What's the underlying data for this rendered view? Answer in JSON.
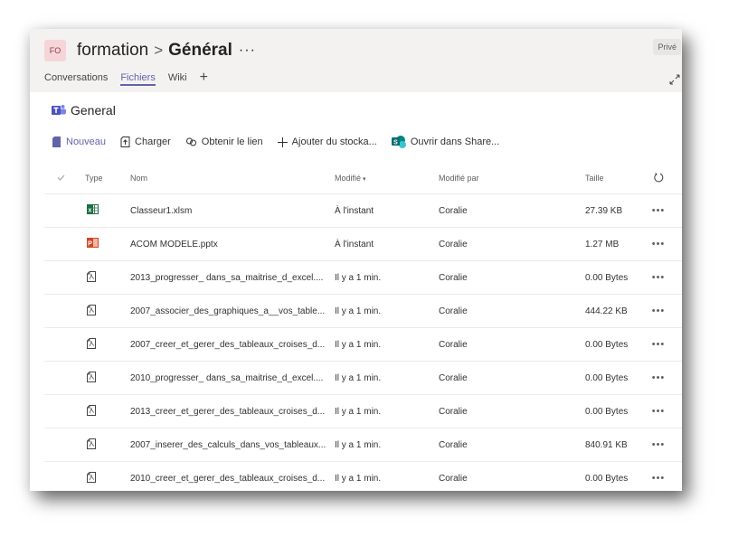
{
  "header": {
    "team_initials": "FO",
    "team_name": "formation",
    "separator": ">",
    "channel_name": "Général",
    "more": "···",
    "private_badge": "Privé"
  },
  "tabs": [
    {
      "label": "Conversations",
      "active": false
    },
    {
      "label": "Fichiers",
      "active": true
    },
    {
      "label": "Wiki",
      "active": false
    }
  ],
  "tab_add": "+",
  "library": {
    "title": "General"
  },
  "commands": {
    "new": "Nouveau",
    "upload": "Charger",
    "get_link": "Obtenir le lien",
    "add_storage": "Ajouter du stocka...",
    "open_sharepoint": "Ouvrir dans Share..."
  },
  "columns": {
    "type": "Type",
    "name": "Nom",
    "modified": "Modifié",
    "modified_sort": "▾",
    "modified_by": "Modifié par",
    "size": "Taille"
  },
  "colors": {
    "accent": "#6264a7",
    "excel": "#1d6f42",
    "powerpoint": "#d24726"
  },
  "files": [
    {
      "type": "excel",
      "name": "Classeur1.xlsm",
      "modified": "À l'instant",
      "modified_by": "Coralie",
      "size": "27.39 KB"
    },
    {
      "type": "powerpoint",
      "name": "ACOM MODELE.pptx",
      "modified": "À l'instant",
      "modified_by": "Coralie",
      "size": "1.27 MB"
    },
    {
      "type": "pdf",
      "name": "2013_progresser_ dans_sa_maitrise_d_excel....",
      "modified": "Il y a 1 min.",
      "modified_by": "Coralie",
      "size": "0.00 Bytes"
    },
    {
      "type": "pdf",
      "name": "2007_associer_des_graphiques_a__vos_table...",
      "modified": "Il y a 1 min.",
      "modified_by": "Coralie",
      "size": "444.22 KB"
    },
    {
      "type": "pdf",
      "name": "2007_creer_et_gerer_des_tableaux_croises_d...",
      "modified": "Il y a 1 min.",
      "modified_by": "Coralie",
      "size": "0.00 Bytes"
    },
    {
      "type": "pdf",
      "name": "2010_progresser_ dans_sa_maitrise_d_excel....",
      "modified": "Il y a 1 min.",
      "modified_by": "Coralie",
      "size": "0.00 Bytes"
    },
    {
      "type": "pdf",
      "name": "2013_creer_et_gerer_des_tableaux_croises_d...",
      "modified": "Il y a 1 min.",
      "modified_by": "Coralie",
      "size": "0.00 Bytes"
    },
    {
      "type": "pdf",
      "name": "2007_inserer_des_calculs_dans_vos_tableaux...",
      "modified": "Il y a 1 min.",
      "modified_by": "Coralie",
      "size": "840.91 KB"
    },
    {
      "type": "pdf",
      "name": "2010_creer_et_gerer_des_tableaux_croises_d...",
      "modified": "Il y a 1 min.",
      "modified_by": "Coralie",
      "size": "0.00 Bytes"
    }
  ],
  "row_more": "•••"
}
